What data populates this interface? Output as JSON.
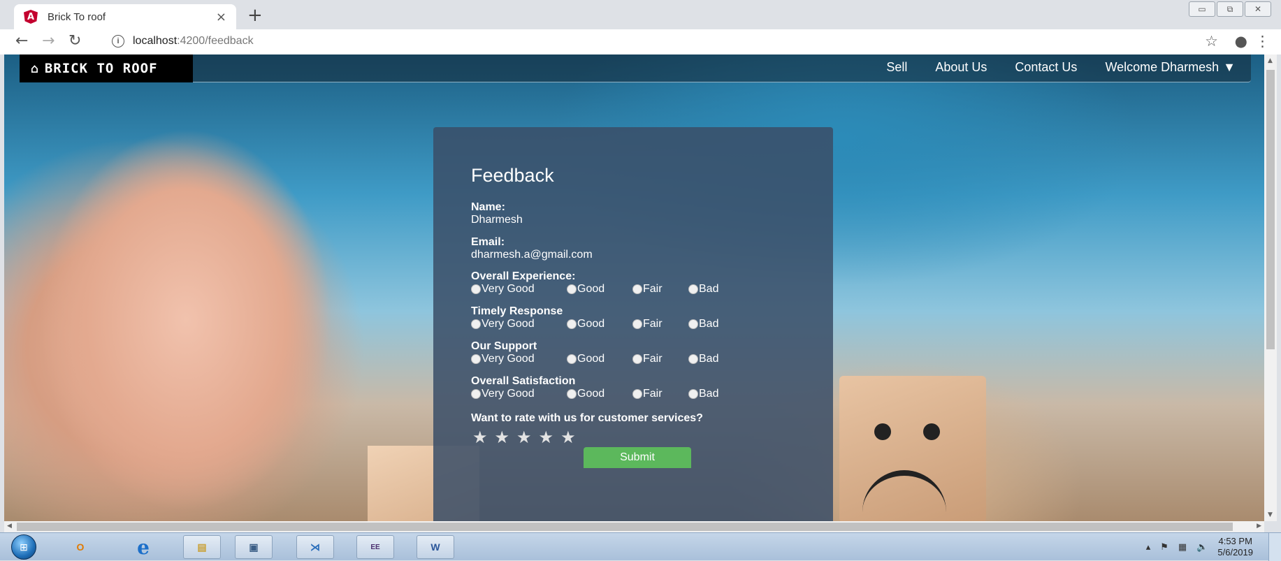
{
  "browser": {
    "tab_title": "Brick To roof",
    "tab_icon": "angular-icon",
    "close_glyph": "×",
    "new_tab_glyph": "+",
    "url_host": "localhost",
    "url_path": ":4200/feedback"
  },
  "navbar": {
    "brand": "BRICK TO ROOF",
    "links": [
      "Sell",
      "About Us",
      "Contact Us"
    ],
    "user_menu": "Welcome Dharmesh"
  },
  "feedback": {
    "title": "Feedback",
    "name_label": "Name:",
    "name_value": "Dharmesh",
    "email_label": "Email:",
    "email_value": "dharmesh.a@gmail.com",
    "options": [
      "Very Good",
      "Good",
      "Fair",
      "Bad"
    ],
    "questions": [
      "Overall Experience:",
      "Timely Response",
      "Our Support",
      "Overall Satisfaction"
    ],
    "rating_question": "Want to rate with us for customer services?",
    "stars": 5,
    "submit_label": "Submit"
  },
  "taskbar": {
    "time": "4:53 PM",
    "date": "5/6/2019"
  },
  "colors": {
    "panel": "#3a4e68",
    "submit": "#5cb85c",
    "brand_bg": "#000000"
  }
}
